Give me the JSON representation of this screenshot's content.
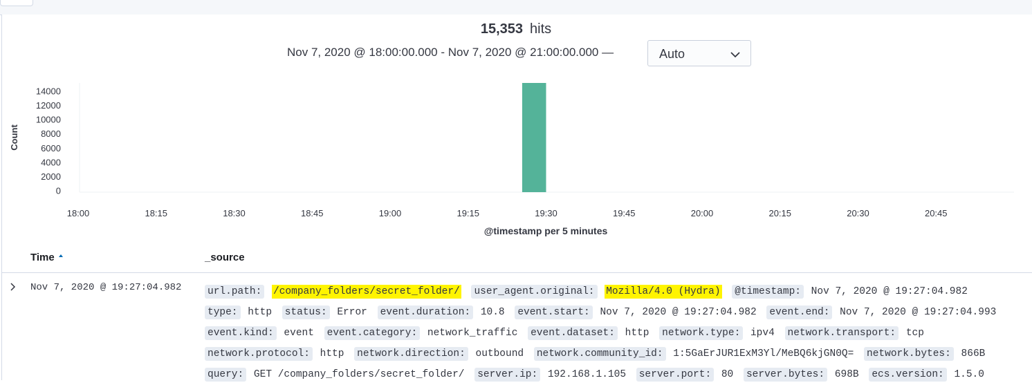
{
  "summary": {
    "hits_count": "15,353",
    "hits_label": "hits",
    "time_range": "Nov 7, 2020 @ 18:00:00.000 - Nov 7, 2020 @ 21:00:00.000 —",
    "interval_value": "Auto"
  },
  "chart_data": {
    "type": "bar",
    "ylabel": "Count",
    "xlabel": "@timestamp per 5 minutes",
    "y_ticks": [
      "14000",
      "12000",
      "10000",
      "8000",
      "6000",
      "4000",
      "2000",
      "0"
    ],
    "x_ticks": [
      "18:00",
      "18:15",
      "18:30",
      "18:45",
      "19:00",
      "19:15",
      "19:30",
      "19:45",
      "20:00",
      "20:15",
      "20:30",
      "20:45"
    ],
    "x_range": [
      "18:00",
      "21:00"
    ],
    "ylim": [
      0,
      15353
    ],
    "bar_color": "#54b399",
    "bars": [
      {
        "x_start": "19:25",
        "x_end": "19:30",
        "value": 15353
      }
    ]
  },
  "table": {
    "columns": {
      "time": "Time",
      "source": "_source"
    },
    "sort_icon": "sort-ascending-icon",
    "expand_icon": "chevron-right-icon",
    "rows": [
      {
        "time": "Nov 7, 2020 @ 19:27:04.982",
        "fields": [
          {
            "key": "url.path:",
            "value": "/company_folders/secret_folder/",
            "highlight": true
          },
          {
            "key": "user_agent.original:",
            "value": "Mozilla/4.0 (Hydra)",
            "highlight": true
          },
          {
            "key": "@timestamp:",
            "value": "Nov 7, 2020 @ 19:27:04.982"
          },
          {
            "key": "type:",
            "value": "http"
          },
          {
            "key": "status:",
            "value": "Error"
          },
          {
            "key": "event.duration:",
            "value": "10.8"
          },
          {
            "key": "event.start:",
            "value": "Nov 7, 2020 @ 19:27:04.982"
          },
          {
            "key": "event.end:",
            "value": "Nov 7, 2020 @ 19:27:04.993"
          },
          {
            "key": "event.kind:",
            "value": "event"
          },
          {
            "key": "event.category:",
            "value": "network_traffic"
          },
          {
            "key": "event.dataset:",
            "value": "http"
          },
          {
            "key": "network.type:",
            "value": "ipv4"
          },
          {
            "key": "network.transport:",
            "value": "tcp"
          },
          {
            "key": "network.protocol:",
            "value": "http"
          },
          {
            "key": "network.direction:",
            "value": "outbound"
          },
          {
            "key": "network.community_id:",
            "value": "1:5GaErJUR1ExM3Yl/MeBQ6kjGN0Q="
          },
          {
            "key": "network.bytes:",
            "value": "866B"
          },
          {
            "key": "query:",
            "value": "GET /company_folders/secret_folder/"
          },
          {
            "key": "server.ip:",
            "value": "192.168.1.105"
          },
          {
            "key": "server.port:",
            "value": "80"
          },
          {
            "key": "server.bytes:",
            "value": "698B"
          },
          {
            "key": "ecs.version:",
            "value": "1.5.0"
          }
        ]
      }
    ]
  }
}
